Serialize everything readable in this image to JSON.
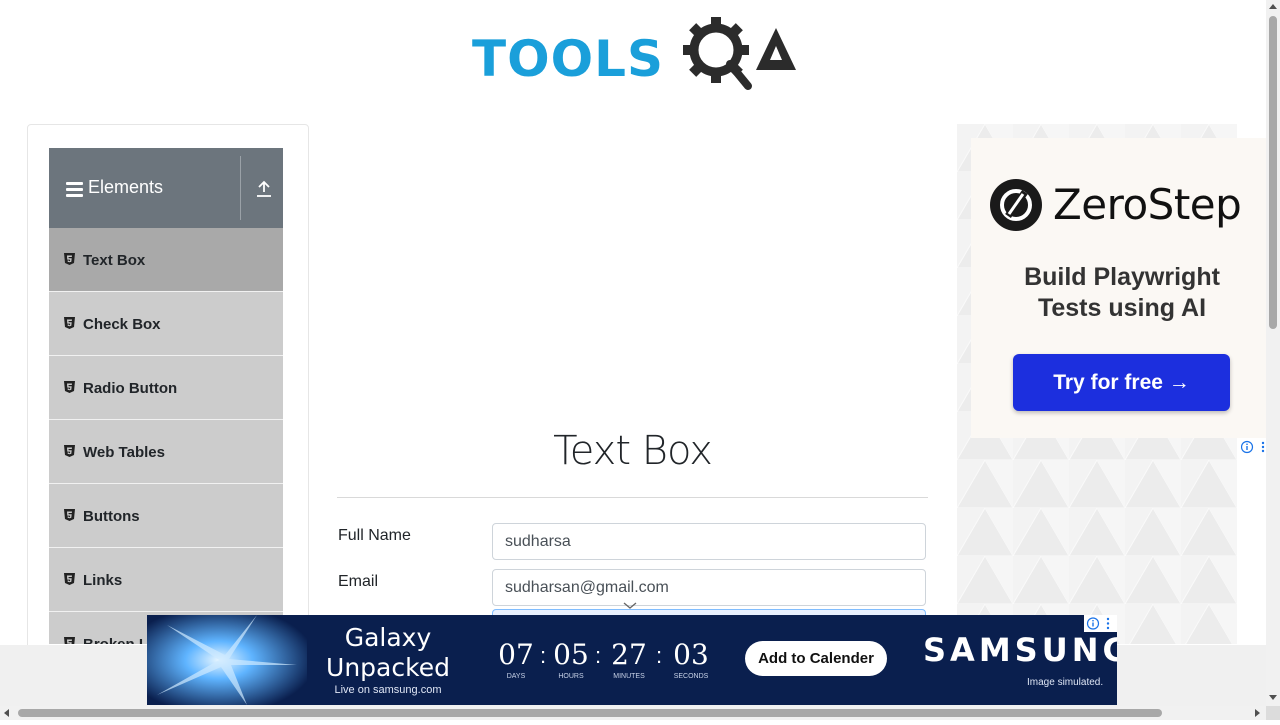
{
  "header": {
    "logo_text": "TOOLS"
  },
  "sidebar": {
    "group_title": "Elements",
    "items": [
      {
        "label": "Text Box",
        "active": true
      },
      {
        "label": "Check Box"
      },
      {
        "label": "Radio Button"
      },
      {
        "label": "Web Tables"
      },
      {
        "label": "Buttons"
      },
      {
        "label": "Links"
      },
      {
        "label": "Broken Links - Images"
      }
    ]
  },
  "main": {
    "title": "Text Box",
    "fields": {
      "full_name": {
        "label": "Full Name",
        "value": "sudharsa"
      },
      "email": {
        "label": "Email",
        "value": "sudharsan@gmail.com"
      }
    }
  },
  "right_ad": {
    "brand": "ZeroStep",
    "tagline": "Build Playwright Tests using AI",
    "cta": "Try for free →"
  },
  "bottom_ad": {
    "title": "Galaxy Unpacked",
    "subtitle": "Live on samsung.com",
    "countdown": [
      {
        "value": "07",
        "unit": "DAYS"
      },
      {
        "value": "05",
        "unit": "HOURS"
      },
      {
        "value": "27",
        "unit": "MINUTES"
      },
      {
        "value": "03",
        "unit": "SECONDS"
      }
    ],
    "cta": "Add to Calender",
    "brand": "SAMSUNG",
    "disclaimer": "Image simulated."
  },
  "colors": {
    "accent": "#1a9fda",
    "sidebar_header": "#6c757d",
    "menu_item": "#cccccc",
    "menu_active": "#a9a9a9",
    "cta_blue": "#1c2fde"
  }
}
